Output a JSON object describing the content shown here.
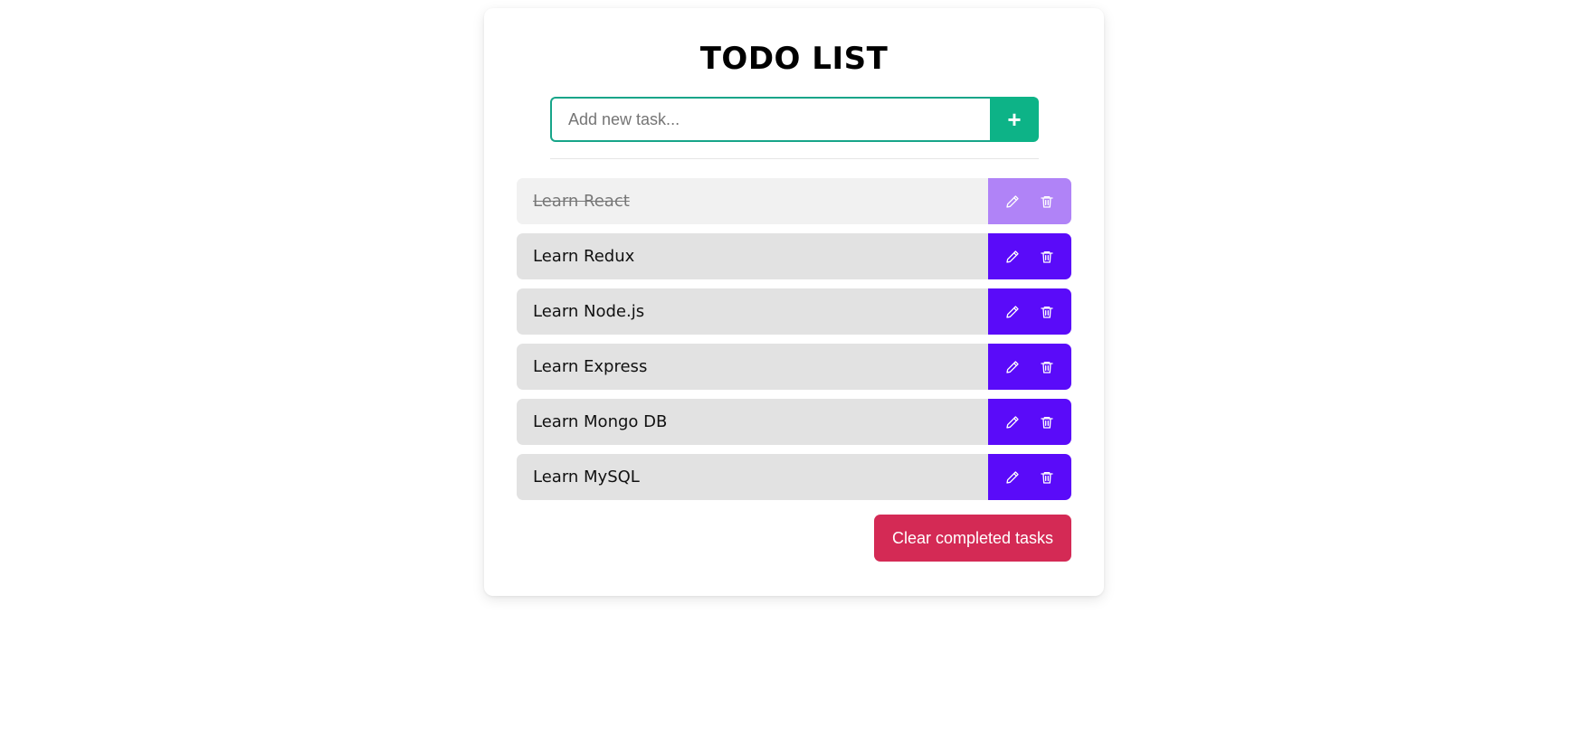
{
  "app": {
    "title": "TODO LIST"
  },
  "add_task": {
    "placeholder": "Add new task...",
    "value": "",
    "button_label": "+"
  },
  "tasks": [
    {
      "label": "Learn React",
      "completed": true
    },
    {
      "label": "Learn Redux",
      "completed": false
    },
    {
      "label": "Learn Node.js",
      "completed": false
    },
    {
      "label": "Learn Express",
      "completed": false
    },
    {
      "label": "Learn Mongo DB",
      "completed": false
    },
    {
      "label": "Learn MySQL",
      "completed": false
    }
  ],
  "task_actions": {
    "edit_icon": "pencil-icon",
    "delete_icon": "trash-icon"
  },
  "footer": {
    "clear_label": "Clear completed tasks"
  },
  "colors": {
    "accent_green": "#0db387",
    "action_purple": "#5a0bf9",
    "action_purple_done": "#b083f7",
    "clear_red": "#d42a55"
  }
}
